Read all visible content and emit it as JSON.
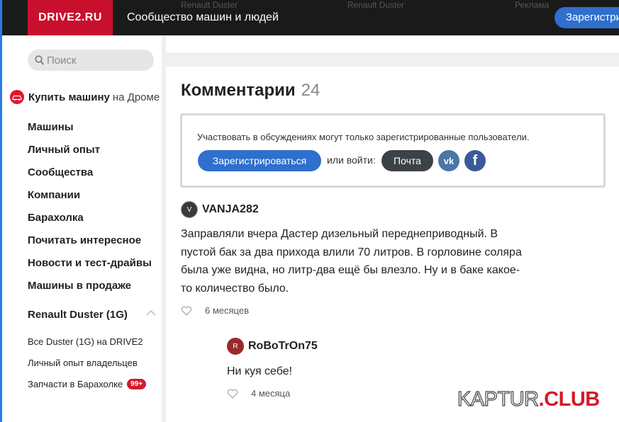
{
  "topbar": {
    "logo": "DRIVE2.RU",
    "tagline": "Сообщество машин и людей",
    "ghost_links": [
      "Renault Duster",
      "Renault Duster",
      "Реклама"
    ],
    "register_label": "Зарегистрироваться"
  },
  "sidebar": {
    "search_placeholder": "Поиск",
    "buy_car": {
      "bold": "Купить машину",
      "rest": "на Дроме"
    },
    "nav": [
      "Машины",
      "Личный опыт",
      "Сообщества",
      "Компании",
      "Барахолка",
      "Почитать интересное",
      "Новости и тест-драйвы",
      "Машины в продаже"
    ],
    "group": {
      "title": "Renault Duster (1G)",
      "items": [
        {
          "label": "Все Duster (1G) на DRIVE2"
        },
        {
          "label": "Личный опыт владельцев"
        },
        {
          "label": "Запчасти в Барахолке",
          "badge": "99+"
        }
      ]
    }
  },
  "comments_section": {
    "title": "Комментарии",
    "count": "24",
    "notice": {
      "text": "Участвовать в обсуждениях могут только зарегистрированные пользователи.",
      "register_label": "Зарегистрироваться",
      "or_login": "или войти:",
      "mail_label": "Почта"
    },
    "comments": [
      {
        "user": "VANJA282",
        "avatar_letter": "V",
        "text": "Заправляли вчера Дастер дизельный переднеприводный. В пустой бак за два прихода влили 70 литров. В горловине соляра была уже видна, но литр-два ещё бы влезло. Ну и в баке какое-то количество было.",
        "time": "6 месяцев"
      },
      {
        "user": "RoBoTrOn75",
        "avatar_letter": "R",
        "text": "Ни куя себе!",
        "time": "4 месяца"
      }
    ]
  },
  "watermark": {
    "part1": "KAPTUR",
    "part2": ".CLUB"
  },
  "colors": {
    "brand": "#c8102e",
    "accent": "#2f6fcd",
    "dark": "#1a1a1a",
    "vk": "#4a76a8",
    "fb": "#3b5998"
  }
}
